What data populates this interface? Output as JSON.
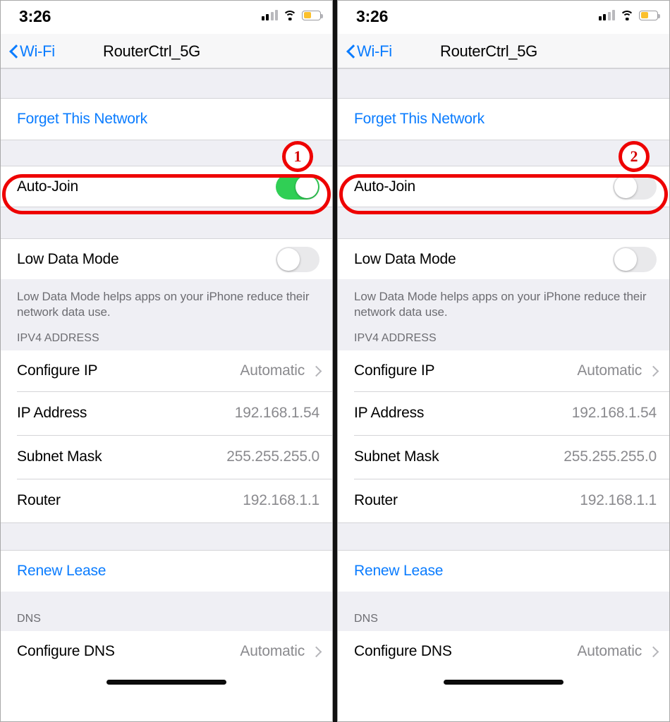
{
  "status_bar": {
    "time": "3:26",
    "cellular_icon": "cellular-signal-icon",
    "wifi_icon": "wifi-icon",
    "battery_icon": "battery-low-power-icon",
    "battery_color": "#fbc02d"
  },
  "nav": {
    "back_label": "Wi-Fi",
    "back_icon": "chevron-left-icon",
    "title": "RouterCtrl_5G",
    "accent_color": "#0a7cff"
  },
  "rows": {
    "forget_network": "Forget This Network",
    "auto_join": "Auto-Join",
    "low_data_mode": "Low Data Mode",
    "low_data_footnote": "Low Data Mode helps apps on your iPhone reduce their network data use.",
    "ipv4_header": "IPV4 ADDRESS",
    "configure_ip_label": "Configure IP",
    "configure_ip_value": "Automatic",
    "ip_address_label": "IP Address",
    "ip_address_value": "192.168.1.54",
    "subnet_mask_label": "Subnet Mask",
    "subnet_mask_value": "255.255.255.0",
    "router_label": "Router",
    "router_value": "192.168.1.1",
    "renew_lease": "Renew Lease",
    "dns_header": "DNS",
    "configure_dns_label": "Configure DNS",
    "configure_dns_value": "Automatic"
  },
  "panels": {
    "left": {
      "auto_join_state": "on",
      "low_data_state": "off",
      "badge": "1"
    },
    "right": {
      "auto_join_state": "off",
      "low_data_state": "off",
      "badge": "2"
    }
  },
  "annotation": {
    "color": "#ee0000"
  }
}
